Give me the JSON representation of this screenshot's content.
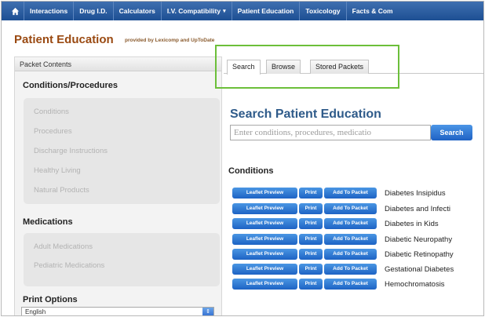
{
  "nav": {
    "home_icon": "home-icon",
    "items": [
      "Interactions",
      "Drug I.D.",
      "Calculators",
      "I.V. Compatibility",
      "Patient Education",
      "Toxicology",
      "Facts & Com"
    ],
    "dropdown_caret": "▾"
  },
  "header": {
    "title": "Patient Education",
    "subtitle": "provided by Lexicomp and UpToDate"
  },
  "sidebar": {
    "header": "Packet Contents",
    "conditions_title": "Conditions/Procedures",
    "conditions_items": [
      "Conditions",
      "Procedures",
      "Discharge Instructions",
      "Healthy Living",
      "Natural Products"
    ],
    "medications_title": "Medications",
    "medications_items": [
      "Adult Medications",
      "Pediatric Medications"
    ],
    "print_title": "Print Options",
    "language_value": "English"
  },
  "tabs": [
    "Search",
    "Browse",
    "Stored Packets"
  ],
  "search": {
    "title": "Search Patient Education",
    "placeholder": "Enter conditions, procedures, medicatio",
    "button": "Search"
  },
  "conditions": {
    "title": "Conditions",
    "button_preview": "Leaflet Preview",
    "button_print": "Print",
    "button_add": "Add To Packet",
    "items": [
      "Diabetes Insipidus",
      "Diabetes and Infecti",
      "Diabetes in Kids",
      "Diabetic Neuropathy",
      "Diabetic Retinopathy",
      "Gestational Diabetes",
      "Hemochromatosis"
    ]
  },
  "colors": {
    "nav_bg": "#1d4f93",
    "title": "#9a4a12",
    "search_title": "#2f5b8a",
    "button_blue": "#1f62c4",
    "highlight": "#6cbf3a"
  }
}
